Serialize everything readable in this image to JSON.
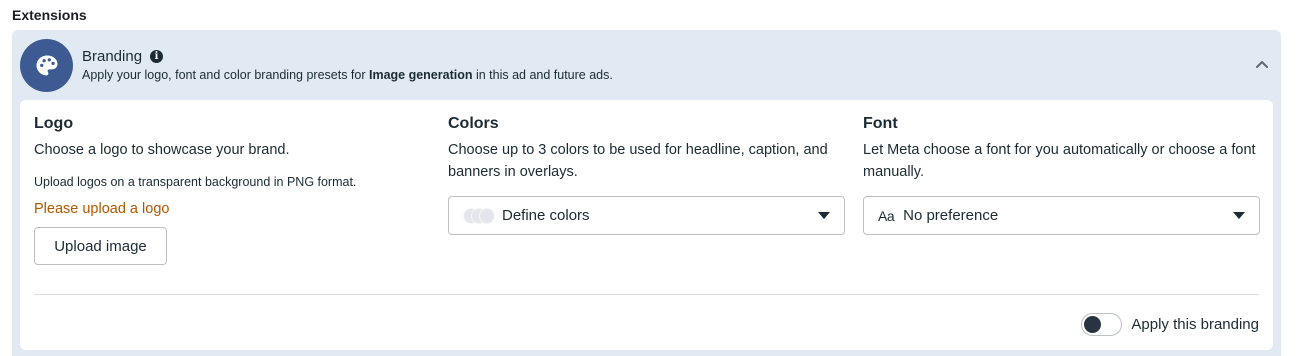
{
  "section": {
    "title": "Extensions"
  },
  "branding": {
    "title": "Branding",
    "info_icon": "i",
    "description_prefix": "Apply your logo, font and color branding presets for ",
    "description_bold": "Image generation",
    "description_suffix": " in this ad and future ads.",
    "avatar_icon": "palette-icon",
    "collapse_icon": "chevron-up-icon"
  },
  "logo": {
    "heading": "Logo",
    "description": "Choose a logo to showcase your brand.",
    "note": "Upload logos on a transparent background in PNG format.",
    "warning": "Please upload a logo",
    "upload_label": "Upload image"
  },
  "colors": {
    "heading": "Colors",
    "description": "Choose up to 3 colors to be used for headline, caption, and banners in overlays.",
    "select_value": "Define colors"
  },
  "font": {
    "heading": "Font",
    "description": "Let Meta choose a font for you automatically or choose a font manually.",
    "select_glyph": "Aa",
    "select_value": "No preference"
  },
  "apply": {
    "label": "Apply this branding",
    "enabled": false
  },
  "colors_theme": {
    "panel_bg": "#e1eaf3",
    "avatar_bg": "#3d5a93",
    "warning": "#b35600",
    "text": "#1c2b33"
  }
}
